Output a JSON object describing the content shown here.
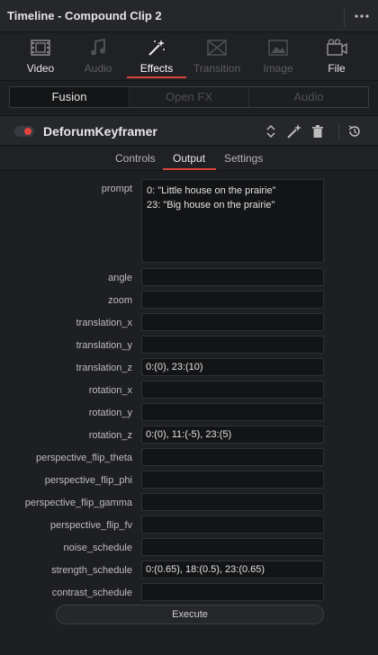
{
  "window": {
    "title": "Timeline - Compound Clip 2",
    "more_icon": "more-dots-icon"
  },
  "tabs": [
    {
      "label": "Video",
      "icon": "film-icon",
      "state": "enabled"
    },
    {
      "label": "Audio",
      "icon": "music-note-icon",
      "state": "disabled"
    },
    {
      "label": "Effects",
      "icon": "magic-wand-icon",
      "state": "selected"
    },
    {
      "label": "Transition",
      "icon": "transition-icon",
      "state": "disabled"
    },
    {
      "label": "Image",
      "icon": "image-icon",
      "state": "disabled"
    },
    {
      "label": "File",
      "icon": "file-icon",
      "state": "enabled"
    }
  ],
  "segments": [
    {
      "label": "Fusion",
      "active": true
    },
    {
      "label": "Open FX",
      "active": false
    },
    {
      "label": "Audio",
      "active": false
    }
  ],
  "node": {
    "name": "DeforumKeyframer",
    "enabled": true,
    "icons": [
      "up-down-arrows-icon",
      "magic-wand-icon",
      "trash-icon",
      "reset-icon"
    ]
  },
  "subtabs": [
    {
      "label": "Controls",
      "selected": false
    },
    {
      "label": "Output",
      "selected": true
    },
    {
      "label": "Settings",
      "selected": false
    }
  ],
  "fields": {
    "prompt": {
      "label": "prompt",
      "lines": [
        "0: \"Little house on the prairie\"",
        "23: \"Big house on the prairie\""
      ]
    },
    "angle": {
      "label": "angle",
      "value": ""
    },
    "zoom": {
      "label": "zoom",
      "value": ""
    },
    "translation_x": {
      "label": "translation_x",
      "value": ""
    },
    "translation_y": {
      "label": "translation_y",
      "value": ""
    },
    "translation_z": {
      "label": "translation_z",
      "value": "0:(0), 23:(10)"
    },
    "rotation_x": {
      "label": "rotation_x",
      "value": ""
    },
    "rotation_y": {
      "label": "rotation_y",
      "value": ""
    },
    "rotation_z": {
      "label": "rotation_z",
      "value": "0:(0), 11:(-5), 23:(5)"
    },
    "perspective_flip_theta": {
      "label": "perspective_flip_theta",
      "value": ""
    },
    "perspective_flip_phi": {
      "label": "perspective_flip_phi",
      "value": ""
    },
    "perspective_flip_gamma": {
      "label": "perspective_flip_gamma",
      "value": ""
    },
    "perspective_flip_fv": {
      "label": "perspective_flip_fv",
      "value": ""
    },
    "noise_schedule": {
      "label": "noise_schedule",
      "value": ""
    },
    "strength_schedule": {
      "label": "strength_schedule",
      "value": "0:(0.65), 18:(0.5), 23:(0.65)"
    },
    "contrast_schedule": {
      "label": "contrast_schedule",
      "value": ""
    }
  },
  "execute_label": "Execute",
  "colors": {
    "accent": "#d8453a",
    "background": "#1e1f22",
    "field_bg": "#131416"
  }
}
